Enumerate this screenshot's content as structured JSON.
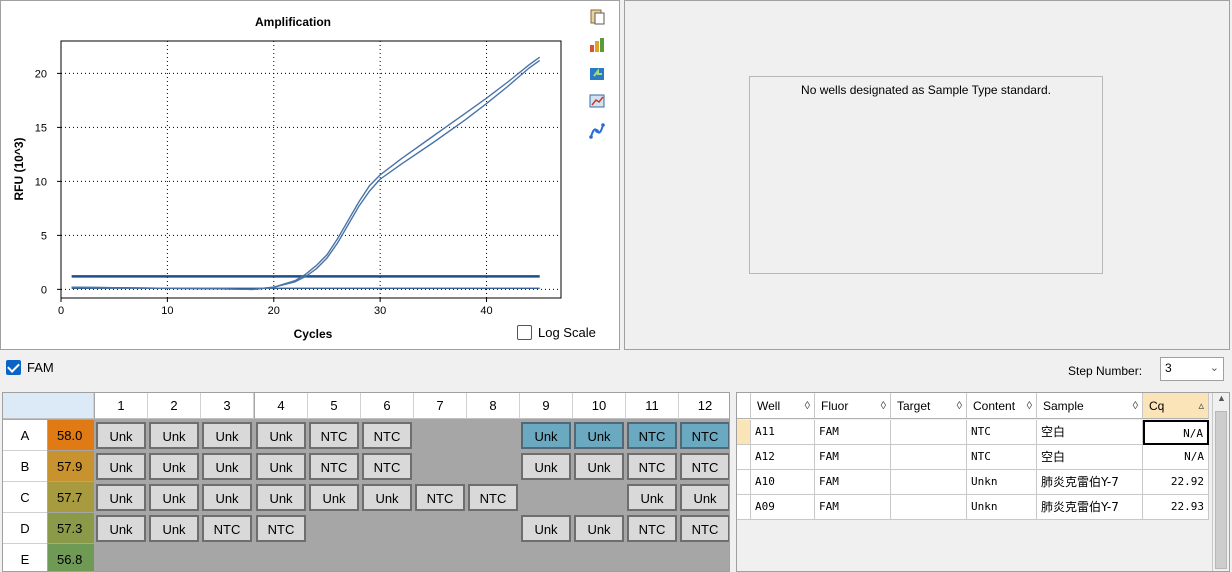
{
  "chart": {
    "title": "Amplification",
    "xlabel": "Cycles",
    "ylabel": "RFU (10^3)",
    "log_scale_label": "Log Scale"
  },
  "chart_data": {
    "type": "line",
    "title": "Amplification",
    "xlabel": "Cycles",
    "ylabel": "RFU (10^3)",
    "xlim": [
      0,
      47
    ],
    "ylim": [
      -0.8,
      23
    ],
    "xticks": [
      0,
      10,
      20,
      30,
      40
    ],
    "yticks": [
      0,
      5,
      10,
      15,
      20
    ],
    "grid": true,
    "threshold": 1.2,
    "series": [
      {
        "color": "#4a73a8",
        "x": [
          1,
          5,
          10,
          15,
          18,
          20,
          22,
          23,
          24,
          25,
          26,
          27,
          28,
          29,
          30,
          32,
          35,
          38,
          40,
          42,
          44,
          45
        ],
        "y": [
          0.2,
          0.15,
          0.1,
          0.05,
          0,
          0.2,
          0.7,
          1.2,
          1.9,
          2.9,
          4.3,
          6.0,
          7.7,
          9.1,
          10.2,
          11.6,
          13.6,
          15.7,
          17.2,
          18.8,
          20.5,
          21.2
        ]
      },
      {
        "color": "#4a73a8",
        "x": [
          1,
          5,
          10,
          15,
          18,
          20,
          22,
          23,
          24,
          25,
          26,
          27,
          28,
          29,
          30,
          32,
          35,
          38,
          40,
          42,
          44,
          45
        ],
        "y": [
          0.2,
          0.15,
          0.1,
          0.05,
          0,
          0.2,
          0.8,
          1.4,
          2.2,
          3.2,
          4.7,
          6.4,
          8.1,
          9.6,
          10.6,
          12.1,
          14.2,
          16.3,
          17.7,
          19.2,
          20.8,
          21.5
        ]
      }
    ]
  },
  "toolbar": {
    "icons": [
      "copy-icon",
      "chart-export-icon",
      "chart-refresh-icon",
      "chart-zoom-icon",
      "curve-settings-icon"
    ]
  },
  "std_panel": {
    "message": "No wells designated as Sample Type standard."
  },
  "fluor": {
    "label": "FAM"
  },
  "step": {
    "label": "Step Number:",
    "value": "3"
  },
  "plate": {
    "columns": [
      "1",
      "2",
      "3",
      "4",
      "5",
      "6",
      "7",
      "8",
      "9",
      "10",
      "11",
      "12"
    ],
    "rows": [
      {
        "label": "A",
        "temp": "58.0",
        "temp_color": "#e07a14",
        "wells": [
          "Unk",
          "Unk",
          "Unk",
          "Unk",
          "NTC",
          "NTC",
          "",
          "",
          "Unk",
          "Unk",
          "NTC",
          "NTC"
        ],
        "selected": [
          9,
          10,
          11,
          12
        ]
      },
      {
        "label": "B",
        "temp": "57.9",
        "temp_color": "#c8922e",
        "wells": [
          "Unk",
          "Unk",
          "Unk",
          "Unk",
          "NTC",
          "NTC",
          "",
          "",
          "Unk",
          "Unk",
          "NTC",
          "NTC"
        ],
        "selected": []
      },
      {
        "label": "C",
        "temp": "57.7",
        "temp_color": "#a89a3e",
        "wells": [
          "Unk",
          "Unk",
          "Unk",
          "Unk",
          "Unk",
          "Unk",
          "NTC",
          "NTC",
          "",
          "",
          "Unk",
          "Unk"
        ],
        "selected": []
      },
      {
        "label": "D",
        "temp": "57.3",
        "temp_color": "#8a9a48",
        "wells": [
          "Unk",
          "Unk",
          "NTC",
          "NTC",
          "",
          "",
          "",
          "",
          "Unk",
          "Unk",
          "NTC",
          "NTC"
        ],
        "selected": []
      },
      {
        "label": "E",
        "temp": "56.8",
        "temp_color": "#6e9a56",
        "wells": [
          "",
          "",
          "",
          "",
          "",
          "",
          "",
          "",
          "",
          "",
          "",
          ""
        ],
        "selected": []
      }
    ]
  },
  "results": {
    "columns": [
      {
        "label": "Well",
        "sort": "◊"
      },
      {
        "label": "Fluor",
        "sort": "◊"
      },
      {
        "label": "Target",
        "sort": "◊"
      },
      {
        "label": "Content",
        "sort": "◊"
      },
      {
        "label": "Sample",
        "sort": "◊"
      },
      {
        "label": "Cq",
        "sort": "▵"
      }
    ],
    "rows": [
      [
        "A11",
        "FAM",
        "",
        "NTC",
        "空白",
        "N/A"
      ],
      [
        "A12",
        "FAM",
        "",
        "NTC",
        "空白",
        "N/A"
      ],
      [
        "A10",
        "FAM",
        "",
        "Unkn",
        "肺炎克雷伯Y-7",
        "22.92"
      ],
      [
        "A09",
        "FAM",
        "",
        "Unkn",
        "肺炎克雷伯Y-7",
        "22.93"
      ]
    ]
  }
}
